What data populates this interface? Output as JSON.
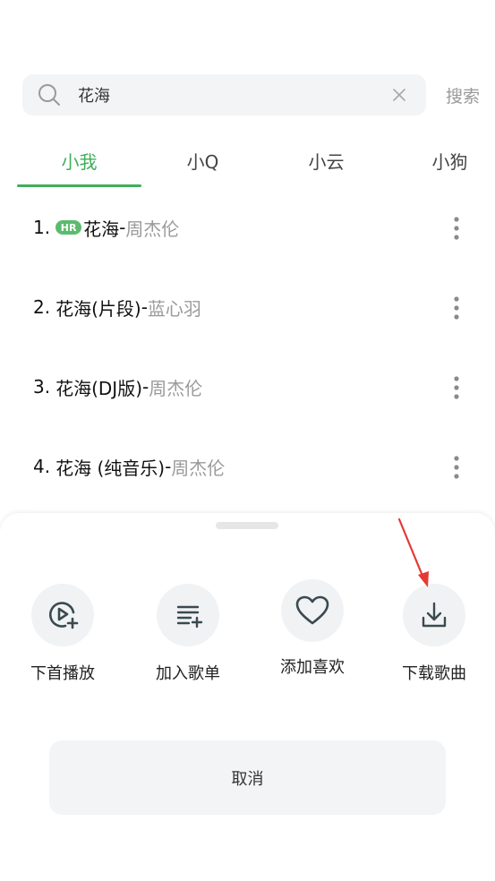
{
  "search": {
    "value": "花海",
    "button_label": "搜索"
  },
  "tabs": [
    {
      "label": "小我",
      "active": true
    },
    {
      "label": "小Q",
      "active": false
    },
    {
      "label": "小云",
      "active": false
    },
    {
      "label": "小狗",
      "active": false
    }
  ],
  "results": [
    {
      "index": "1.",
      "badge": "HR",
      "title": "花海",
      "sep": "-",
      "artist": "周杰伦"
    },
    {
      "index": "2.",
      "title": "花海(片段)",
      "sep": "-",
      "artist": "蓝心羽"
    },
    {
      "index": "3.",
      "title": "花海(DJ版)",
      "sep": "-",
      "artist": "周杰伦"
    },
    {
      "index": "4.",
      "title": "花海 (纯音乐)",
      "sep": "-",
      "artist": "周杰伦"
    }
  ],
  "sheet": {
    "actions": [
      {
        "label": "下首播放",
        "icon": "play-next-icon"
      },
      {
        "label": "加入歌单",
        "icon": "add-to-playlist-icon"
      },
      {
        "label": "添加喜欢",
        "icon": "heart-icon"
      },
      {
        "label": "下载歌曲",
        "icon": "download-icon"
      }
    ],
    "cancel_label": "取消"
  },
  "colors": {
    "accent": "#3fae5a",
    "badge": "#5bbb6d",
    "annotation": "#e53935"
  }
}
